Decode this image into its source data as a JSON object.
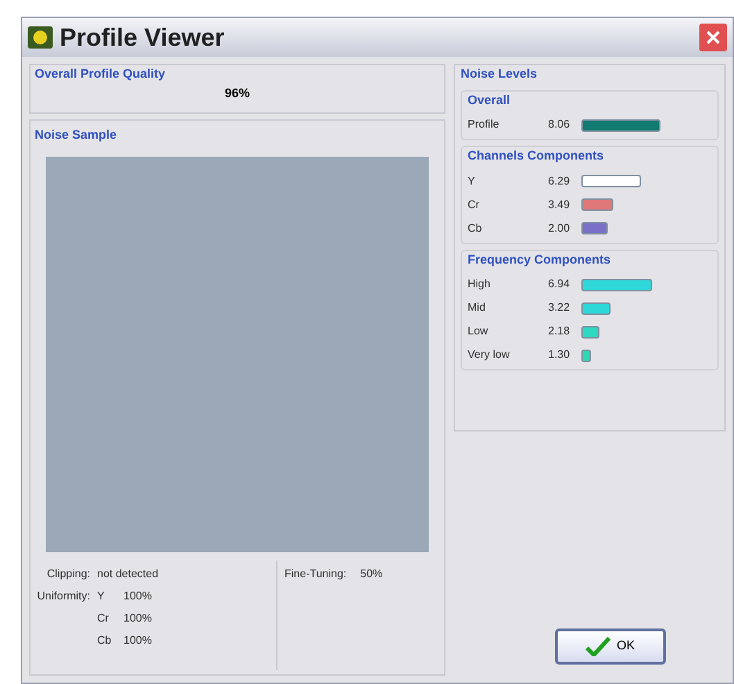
{
  "window": {
    "title": "Profile Viewer"
  },
  "overall_quality": {
    "title": "Overall Profile Quality",
    "value": "96%"
  },
  "noise_sample": {
    "title": "Noise Sample"
  },
  "clipping": {
    "label": "Clipping:",
    "value": "not detected"
  },
  "uniformity": {
    "label": "Uniformity:",
    "rows": [
      {
        "channel": "Y",
        "value": "100%"
      },
      {
        "channel": "Cr",
        "value": "100%"
      },
      {
        "channel": "Cb",
        "value": "100%"
      }
    ]
  },
  "fine_tuning": {
    "label": "Fine-Tuning:",
    "value": "50%"
  },
  "noise_levels": {
    "title": "Noise Levels",
    "groups": [
      {
        "title": "Overall",
        "items": [
          {
            "label": "Profile",
            "value": "8.06",
            "color": "#127a70"
          }
        ]
      },
      {
        "title": "Channels Components",
        "items": [
          {
            "label": "Y",
            "value": "6.29",
            "color": "#ffffff"
          },
          {
            "label": "Cr",
            "value": "3.49",
            "color": "#e07878"
          },
          {
            "label": "Cb",
            "value": "2.00",
            "color": "#7b70c8"
          }
        ]
      },
      {
        "title": "Frequency Components",
        "items": [
          {
            "label": "High",
            "value": "6.94",
            "color": "#2fd8d8"
          },
          {
            "label": "Mid",
            "value": "3.22",
            "color": "#2fd8d8"
          },
          {
            "label": "Low",
            "value": "2.18",
            "color": "#2fd8c0"
          },
          {
            "label": "Very low",
            "value": "1.30",
            "color": "#2fd8b0"
          }
        ]
      }
    ]
  },
  "ok_button": {
    "label": "OK"
  }
}
